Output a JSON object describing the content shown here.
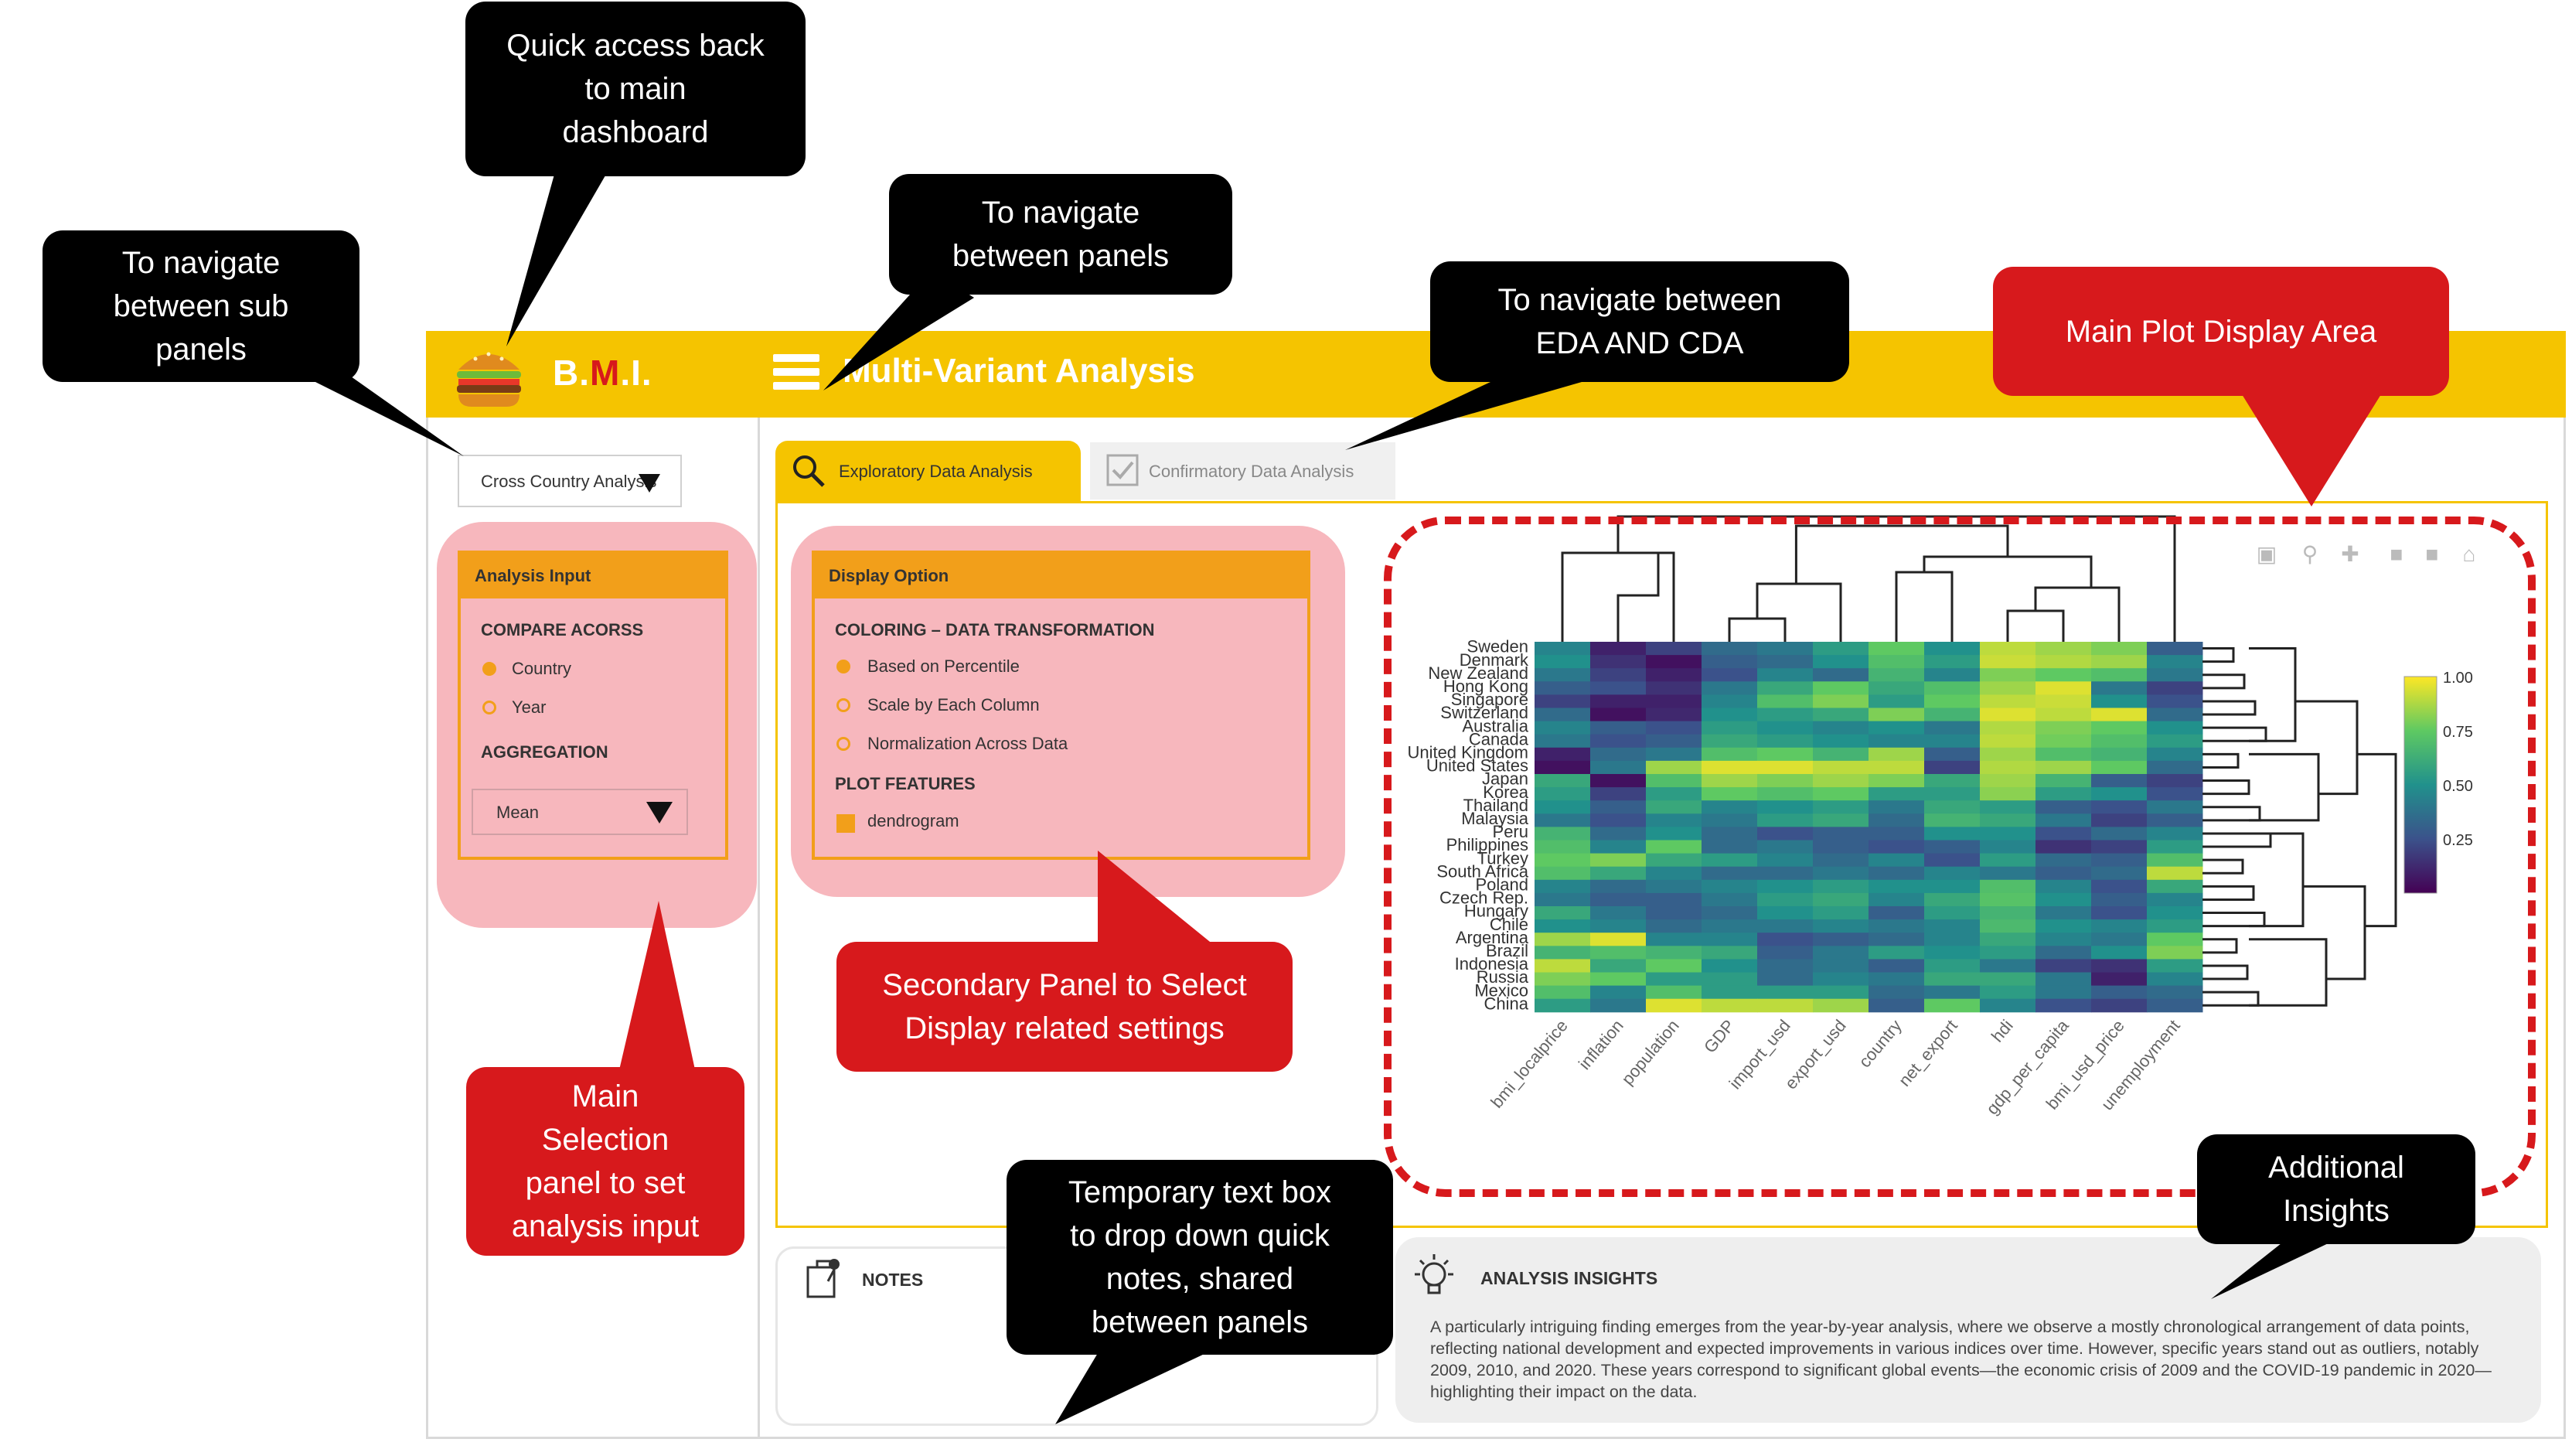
{
  "app": {
    "logo_prefix": "B.",
    "logo_m": "M",
    "logo_suffix": ".I.",
    "panel_title": "Multi-Variant Analysis"
  },
  "sub_panel_select": {
    "value": "Cross Country Analysis"
  },
  "tabs": [
    {
      "label": "Exploratory Data Analysis",
      "active": true
    },
    {
      "label": "Confirmatory Data Analysis",
      "active": false
    }
  ],
  "analysis_input": {
    "title": "Analysis Input",
    "compare_label": "COMPARE ACORSS",
    "compare_options": [
      {
        "label": "Country",
        "selected": true
      },
      {
        "label": "Year",
        "selected": false
      }
    ],
    "aggregation_label": "AGGREGATION",
    "aggregation_value": "Mean"
  },
  "display_option": {
    "title": "Display Option",
    "coloring_label": "COLORING – DATA TRANSFORMATION",
    "coloring_options": [
      {
        "label": "Based on Percentile",
        "selected": true
      },
      {
        "label": "Scale by Each Column",
        "selected": false
      },
      {
        "label": "Normalization Across Data",
        "selected": false
      }
    ],
    "plot_features_label": "PLOT FEATURES",
    "plot_feature": "dendrogram"
  },
  "plot_toolbar_icons": [
    "camera-icon",
    "zoom-icon",
    "pan-icon",
    "zoom-in-box-icon",
    "zoom-out-box-icon",
    "home-icon"
  ],
  "chart_data": {
    "type": "heatmap",
    "rows": [
      "Sweden",
      "Denmark",
      "New Zealand",
      "Hong Kong",
      "Singapore",
      "Switzerland",
      "Australia",
      "Canada",
      "United Kingdom",
      "United States",
      "Japan",
      "Korea",
      "Thailand",
      "Malaysia",
      "Peru",
      "Philippines",
      "Turkey",
      "South Africa",
      "Poland",
      "Czech Rep.",
      "Hungary",
      "Chile",
      "Argentina",
      "Brazil",
      "Indonesia",
      "Russia",
      "Mexico",
      "China"
    ],
    "columns": [
      "bmi_localprice",
      "inflation",
      "population",
      "GDP",
      "import_usd",
      "export_usd",
      "country",
      "net_export",
      "hdi",
      "gdp_per_capita",
      "bmi_usd_price",
      "unemployment"
    ],
    "colorbar_ticks": [
      "1.00",
      "0.75",
      "0.50",
      "0.25"
    ],
    "value_range": [
      0,
      1
    ],
    "colormap": "viridis",
    "dendrogram": true,
    "values": [
      [
        0.45,
        0.1,
        0.2,
        0.35,
        0.4,
        0.55,
        0.75,
        0.5,
        0.9,
        0.85,
        0.8,
        0.3
      ],
      [
        0.5,
        0.15,
        0.05,
        0.3,
        0.35,
        0.5,
        0.7,
        0.55,
        0.92,
        0.88,
        0.85,
        0.45
      ],
      [
        0.4,
        0.2,
        0.1,
        0.25,
        0.45,
        0.35,
        0.65,
        0.45,
        0.8,
        0.75,
        0.7,
        0.4
      ],
      [
        0.3,
        0.25,
        0.15,
        0.4,
        0.6,
        0.75,
        0.6,
        0.7,
        0.85,
        0.95,
        0.4,
        0.2
      ],
      [
        0.2,
        0.1,
        0.1,
        0.45,
        0.7,
        0.8,
        0.55,
        0.75,
        0.9,
        0.92,
        0.5,
        0.25
      ],
      [
        0.35,
        0.05,
        0.12,
        0.5,
        0.55,
        0.6,
        0.8,
        0.65,
        0.95,
        0.9,
        0.95,
        0.35
      ],
      [
        0.45,
        0.3,
        0.25,
        0.55,
        0.5,
        0.45,
        0.5,
        0.4,
        0.88,
        0.8,
        0.75,
        0.5
      ],
      [
        0.4,
        0.25,
        0.3,
        0.6,
        0.55,
        0.5,
        0.45,
        0.45,
        0.9,
        0.78,
        0.7,
        0.55
      ],
      [
        0.1,
        0.35,
        0.4,
        0.7,
        0.75,
        0.65,
        0.85,
        0.3,
        0.85,
        0.7,
        0.65,
        0.45
      ],
      [
        0.05,
        0.4,
        0.85,
        0.95,
        0.95,
        0.9,
        0.9,
        0.2,
        0.88,
        0.85,
        0.75,
        0.35
      ],
      [
        0.6,
        0.05,
        0.7,
        0.85,
        0.8,
        0.85,
        0.8,
        0.6,
        0.85,
        0.65,
        0.3,
        0.2
      ],
      [
        0.55,
        0.2,
        0.55,
        0.75,
        0.7,
        0.75,
        0.55,
        0.55,
        0.82,
        0.55,
        0.5,
        0.25
      ],
      [
        0.5,
        0.3,
        0.6,
        0.45,
        0.5,
        0.55,
        0.4,
        0.6,
        0.55,
        0.3,
        0.25,
        0.4
      ],
      [
        0.4,
        0.25,
        0.45,
        0.4,
        0.55,
        0.6,
        0.35,
        0.65,
        0.6,
        0.4,
        0.2,
        0.3
      ],
      [
        0.65,
        0.35,
        0.5,
        0.35,
        0.25,
        0.3,
        0.3,
        0.5,
        0.5,
        0.25,
        0.35,
        0.45
      ],
      [
        0.7,
        0.45,
        0.75,
        0.35,
        0.4,
        0.3,
        0.25,
        0.3,
        0.45,
        0.15,
        0.2,
        0.55
      ],
      [
        0.75,
        0.8,
        0.6,
        0.55,
        0.45,
        0.35,
        0.45,
        0.25,
        0.55,
        0.35,
        0.3,
        0.7
      ],
      [
        0.7,
        0.6,
        0.45,
        0.35,
        0.35,
        0.4,
        0.35,
        0.45,
        0.4,
        0.3,
        0.35,
        0.9
      ],
      [
        0.45,
        0.35,
        0.4,
        0.45,
        0.5,
        0.55,
        0.5,
        0.5,
        0.7,
        0.45,
        0.25,
        0.6
      ],
      [
        0.4,
        0.3,
        0.3,
        0.4,
        0.55,
        0.6,
        0.45,
        0.6,
        0.72,
        0.5,
        0.3,
        0.45
      ],
      [
        0.6,
        0.4,
        0.3,
        0.35,
        0.5,
        0.55,
        0.3,
        0.55,
        0.65,
        0.4,
        0.25,
        0.5
      ],
      [
        0.5,
        0.45,
        0.35,
        0.4,
        0.4,
        0.45,
        0.4,
        0.45,
        0.68,
        0.5,
        0.45,
        0.55
      ],
      [
        0.85,
        0.95,
        0.45,
        0.45,
        0.25,
        0.3,
        0.35,
        0.45,
        0.6,
        0.45,
        0.4,
        0.75
      ],
      [
        0.65,
        0.7,
        0.65,
        0.6,
        0.3,
        0.4,
        0.55,
        0.5,
        0.55,
        0.35,
        0.5,
        0.8
      ],
      [
        0.9,
        0.6,
        0.75,
        0.5,
        0.35,
        0.4,
        0.3,
        0.55,
        0.4,
        0.2,
        0.15,
        0.55
      ],
      [
        0.8,
        0.75,
        0.55,
        0.55,
        0.35,
        0.45,
        0.4,
        0.6,
        0.6,
        0.4,
        0.1,
        0.45
      ],
      [
        0.7,
        0.45,
        0.7,
        0.55,
        0.55,
        0.55,
        0.35,
        0.4,
        0.55,
        0.4,
        0.3,
        0.35
      ],
      [
        0.55,
        0.4,
        0.95,
        0.9,
        0.9,
        0.85,
        0.3,
        0.75,
        0.45,
        0.25,
        0.2,
        0.3
      ]
    ]
  },
  "notes": {
    "label": "NOTES"
  },
  "insights": {
    "label": "ANALYSIS INSIGHTS",
    "text": "A particularly intriguing finding emerges from the year-by-year analysis, where we observe a mostly chronological arrangement of data points, reflecting national development and expected improvements in various indices over time. However, specific years stand out as outliers, notably 2009, 2010, and 2020. These years correspond to significant global events—the economic crisis of 2009 and the COVID-19 pandemic in 2020—highlighting their impact on the data."
  },
  "callouts": {
    "quick_access": "Quick access back\nto main\ndashboard",
    "sub_panels": "To navigate\nbetween sub\npanels",
    "panels": "To navigate\nbetween panels",
    "eda_cda": "To navigate between\nEDA AND CDA",
    "main_plot": "Main Plot Display Area",
    "secondary_panel": "Secondary Panel to Select\nDisplay related settings",
    "main_selection": "Main\nSelection\npanel to set\nanalysis input",
    "notes_box": "Temporary text box\nto drop down quick\nnotes, shared\nbetween panels",
    "additional_insights": "Additional\nInsights"
  },
  "colors": {
    "header": "#f5c400",
    "accent_orange": "#f29f1a",
    "highlight_pink": "#f7b7bd",
    "callout_red": "#d7191c",
    "callout_black": "#000000"
  }
}
